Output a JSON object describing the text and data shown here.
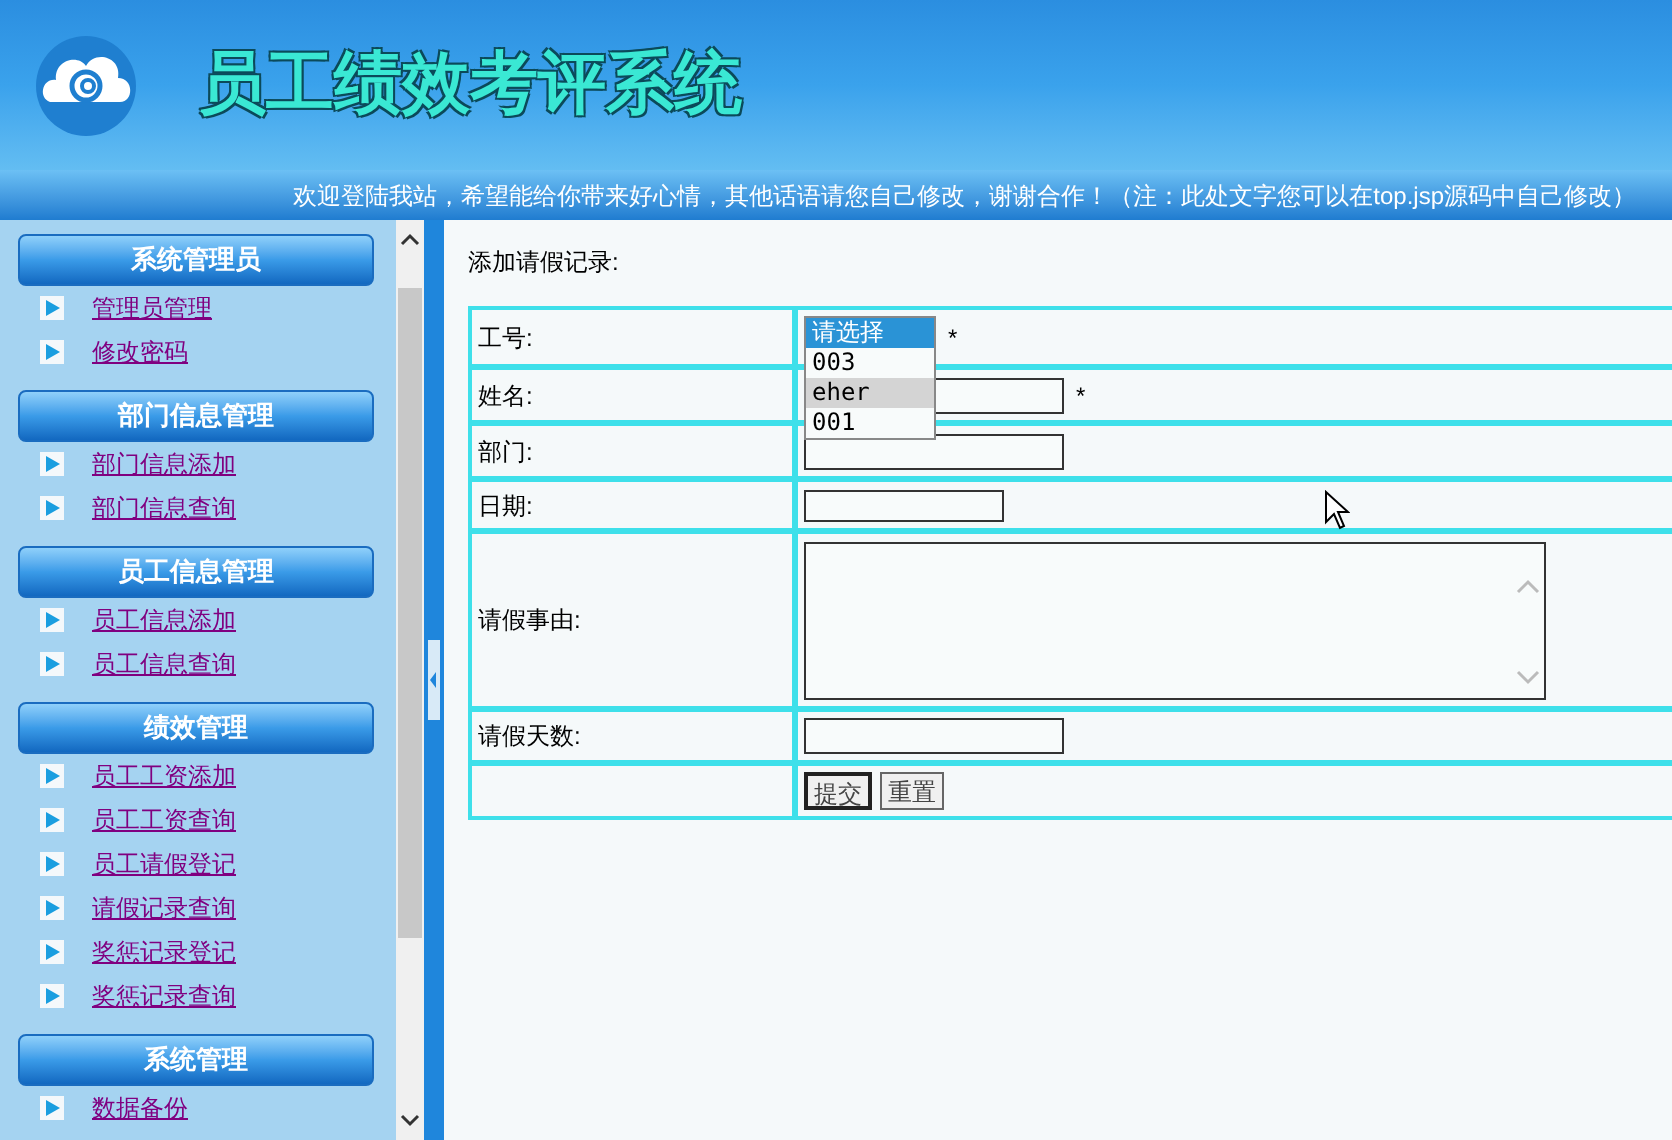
{
  "header": {
    "title": "员工绩效考评系统",
    "marquee": "欢迎登陆我站，希望能给你带来好心情，其他话语请您自己修改，谢谢合作！（注：此处文字您可以在top.jsp源码中自己修改）"
  },
  "sidebar": {
    "groups": [
      {
        "title": "系统管理员",
        "items": [
          "管理员管理",
          "修改密码"
        ]
      },
      {
        "title": "部门信息管理",
        "items": [
          "部门信息添加",
          "部门信息查询"
        ]
      },
      {
        "title": "员工信息管理",
        "items": [
          "员工信息添加",
          "员工信息查询"
        ]
      },
      {
        "title": "绩效管理",
        "items": [
          "员工工资添加",
          "员工工资查询",
          "员工请假登记",
          "请假记录查询",
          "奖惩记录登记",
          "奖惩记录查询"
        ]
      },
      {
        "title": "系统管理",
        "items": [
          "数据备份"
        ]
      }
    ]
  },
  "form": {
    "heading": "添加请假记录:",
    "rows": [
      {
        "label": "工号:",
        "kind": "select",
        "note": "*",
        "options": [
          {
            "text": "请选择",
            "selected": true,
            "hovered": false
          },
          {
            "text": "003",
            "selected": false,
            "hovered": false
          },
          {
            "text": "eher",
            "selected": false,
            "hovered": true
          },
          {
            "text": "001",
            "selected": false,
            "hovered": false
          }
        ]
      },
      {
        "label": "姓名:",
        "kind": "text",
        "note": "*"
      },
      {
        "label": "部门:",
        "kind": "text"
      },
      {
        "label": "日期:",
        "kind": "date"
      },
      {
        "label": "请假事由:",
        "kind": "textarea"
      },
      {
        "label": "请假天数:",
        "kind": "text"
      }
    ],
    "buttons": [
      "提交",
      "重置"
    ]
  }
}
